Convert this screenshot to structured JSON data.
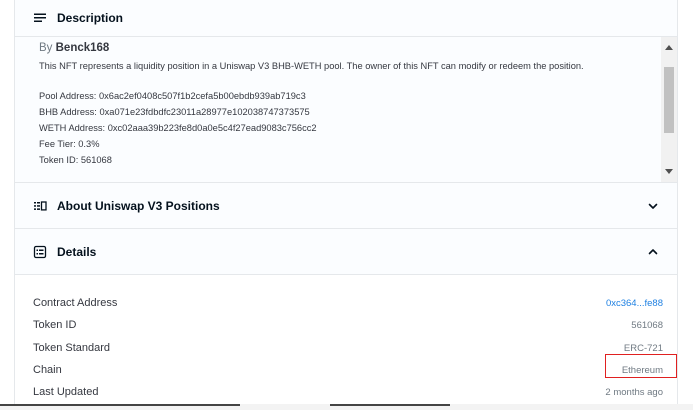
{
  "description": {
    "title": "Description",
    "by_prefix": "By",
    "author": "Benck168",
    "paragraph": "This NFT represents a liquidity position in a Uniswap V3 BHB-WETH pool. The owner of this NFT can modify or redeem the position.",
    "lines": [
      "Pool Address: 0x6ac2ef0408c507f1b2cefa5b00ebdb939ab719c3",
      "BHB Address: 0xa071e23fdbdfc23011a28977e102038747373575",
      "WETH Address: 0xc02aaa39b223fe8d0a0e5c4f27ead9083c756cc2",
      "Fee Tier: 0.3%",
      "Token ID: 561068"
    ]
  },
  "about": {
    "title": "About Uniswap V3 Positions"
  },
  "details": {
    "title": "Details",
    "rows": [
      {
        "label": "Contract Address",
        "value": "0xc364...fe88"
      },
      {
        "label": "Token ID",
        "value": "561068"
      },
      {
        "label": "Token Standard",
        "value": "ERC-721"
      },
      {
        "label": "Chain",
        "value": "Ethereum"
      },
      {
        "label": "Last Updated",
        "value": "2 months ago"
      }
    ]
  },
  "icons": {
    "description": "lines-icon",
    "about": "list-icon",
    "details": "details-icon",
    "chevron_down": "chevron-down-icon",
    "chevron_up": "chevron-up-icon"
  },
  "colors": {
    "link": "#2081e2",
    "highlight": "#e02020",
    "border": "#e5e8eb"
  }
}
